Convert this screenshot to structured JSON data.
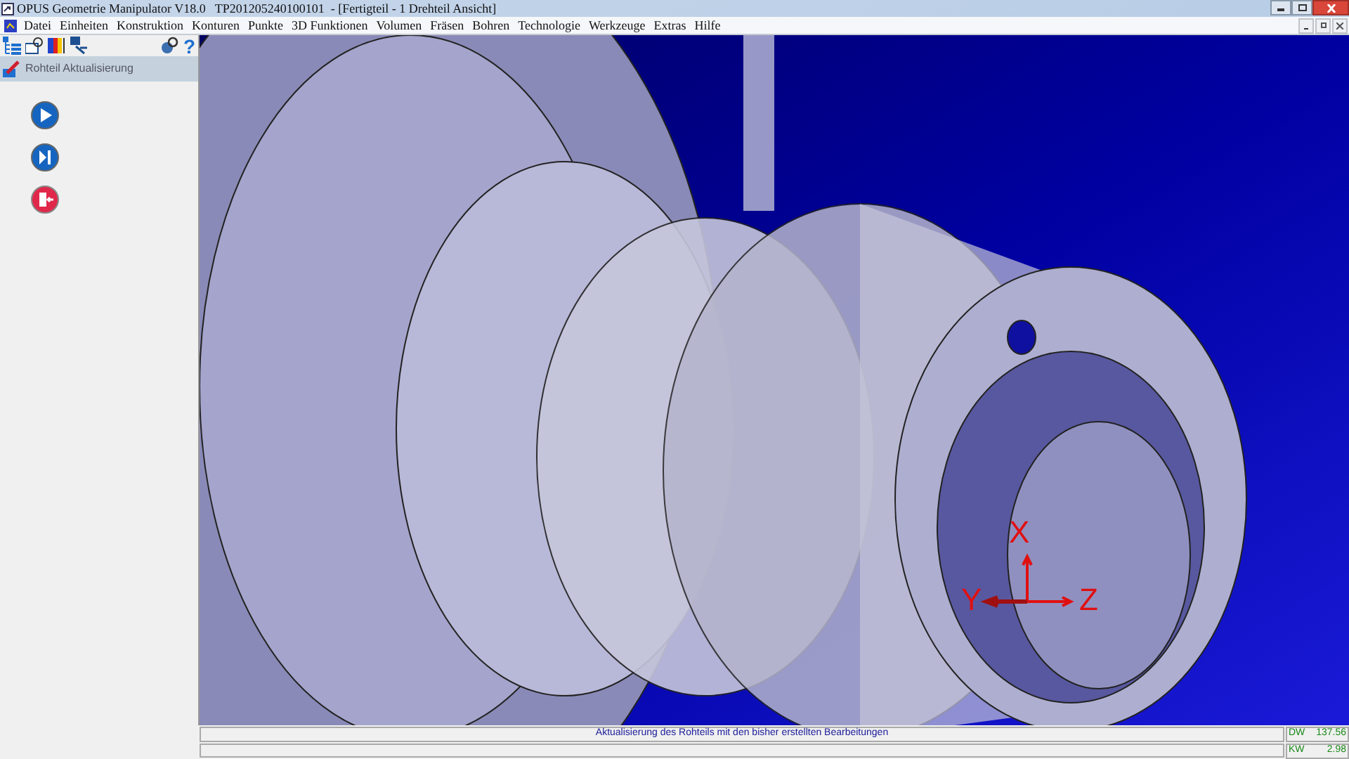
{
  "window": {
    "title": "OPUS Geometrie Manipulator V18.0   TP201205240100101  - [Fertigteil - 1 Drehteil Ansicht]"
  },
  "menu": [
    "Datei",
    "Einheiten",
    "Konstruktion",
    "Konturen",
    "Punkte",
    "3D Funktionen",
    "Volumen",
    "Fräsen",
    "Bohren",
    "Technologie",
    "Werkzeuge",
    "Extras",
    "Hilfe"
  ],
  "sidebar": {
    "help": "?",
    "header": "Rohteil Aktualisierung",
    "actions": [
      {
        "kind": "play"
      },
      {
        "kind": "step"
      },
      {
        "kind": "exit"
      }
    ]
  },
  "viewport": {
    "axes": {
      "x": "X",
      "y": "Y",
      "z": "Z"
    }
  },
  "status_bar": {
    "message": "Aktualisierung des Rohteils mit den bisher erstellten Bearbeitungen",
    "readouts": [
      {
        "label": "DW",
        "value": "137.56"
      },
      {
        "label": "KW",
        "value": "2.98"
      }
    ]
  }
}
